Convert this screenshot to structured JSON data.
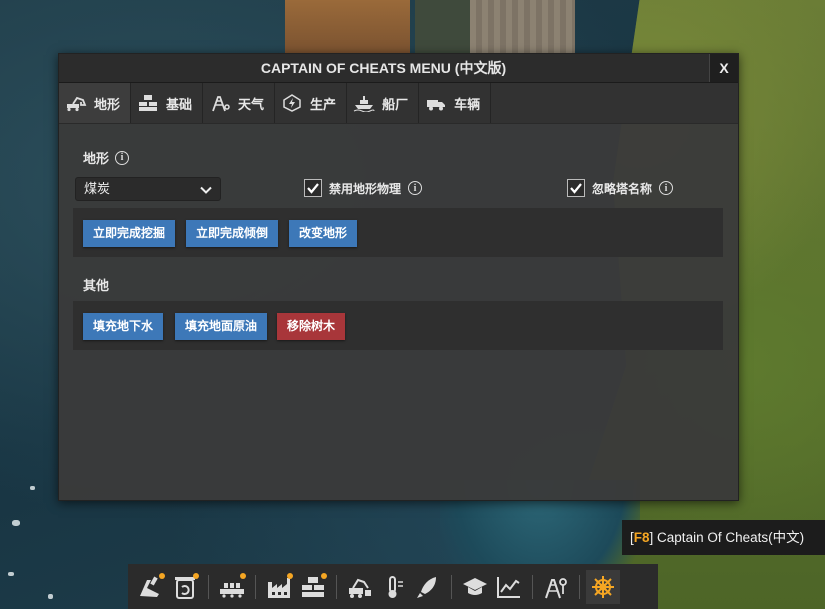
{
  "window": {
    "title": "CAPTAIN OF CHEATS MENU (中文版)",
    "close_label": "X"
  },
  "tabs": [
    {
      "label": "地形",
      "icon": "excavator-icon"
    },
    {
      "label": "基础",
      "icon": "building-icon"
    },
    {
      "label": "天气",
      "icon": "weather-icon"
    },
    {
      "label": "生产",
      "icon": "power-icon"
    },
    {
      "label": "船厂",
      "icon": "ship-icon"
    },
    {
      "label": "车辆",
      "icon": "truck-icon"
    }
  ],
  "terrain": {
    "section_label": "地形",
    "material_select": {
      "value": "煤炭"
    },
    "disable_physics": {
      "label": "禁用地形物理",
      "checked": true
    },
    "ignore_tower_names": {
      "label": "忽略塔名称",
      "checked": true
    },
    "buttons": [
      "立即完成挖掘",
      "立即完成倾倒",
      "改变地形"
    ]
  },
  "other": {
    "section_label": "其他",
    "buttons": [
      {
        "label": "填充地下水",
        "color": "#3d78b8"
      },
      {
        "label": "填充地面原油",
        "color": "#3d78b8"
      },
      {
        "label": "移除树木",
        "color": "#a8363a"
      }
    ]
  },
  "tooltip": {
    "key": "F8",
    "text": "Captain Of Cheats(中文)"
  },
  "toolbar": {
    "icons": [
      "mining-icon",
      "recycle-icon",
      "conveyor-icon",
      "factory-icon",
      "storage-icon",
      "truck-tools-icon",
      "thermometer-icon",
      "rocket-icon",
      "research-icon",
      "stats-icon",
      "map-icon",
      "helm-icon"
    ]
  },
  "colors": {
    "accent": "#f5a623",
    "blue_button": "#3d78b8",
    "red_button": "#a8363a"
  }
}
